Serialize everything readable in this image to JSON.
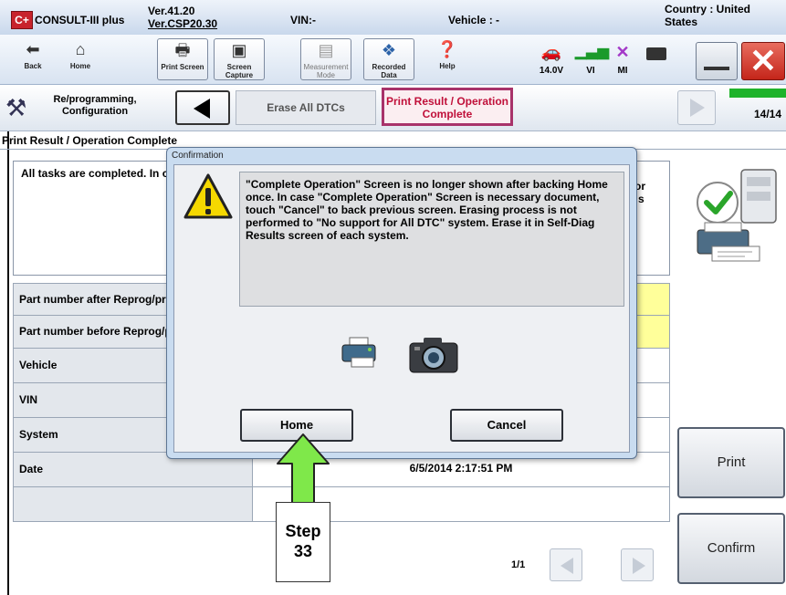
{
  "window": {
    "app_title": "CONSULT-III plus",
    "logo_text": "C+",
    "version_line1": "Ver.41.20",
    "version_line2": "Ver.CSP20.30",
    "vin_label": "VIN:-",
    "vehicle_label": "Vehicle : -",
    "country_label": "Country : United States"
  },
  "toolbar": {
    "back_label": "Back",
    "home_label": "Home",
    "print_screen_label": "Print Screen",
    "screen_capture_label": "Screen Capture",
    "measurement_mode_label": "Measurement Mode",
    "recorded_data_label": "Recorded Data",
    "help_label": "Help",
    "battery_voltage": "14.0V",
    "vi_label": "VI",
    "mi_label": "MI",
    "icons": [
      "back-arrow-icon",
      "home-icon",
      "printer-icon",
      "camera-icon",
      "measurement-icon",
      "recorded-data-icon",
      "help-icon",
      "car-icon",
      "signal-icon",
      "mi-x-icon",
      "close-icon",
      "minimize-icon"
    ]
  },
  "nav": {
    "reprog_label": "Re/programming, Configuration",
    "crumb_erase": "Erase All DTCs",
    "crumb_print": "Print Result / Operation Complete",
    "progress": "14/14",
    "progress_fraction": 1.0,
    "progress_color": "#1fb32b"
  },
  "page": {
    "title": "Print Result / Operation Complete",
    "message": "All tasks are completed. In case CONSULT can N temporally storage of thi Data Folder\" on desk top",
    "message_right_1": "or",
    "message_right_2": "s",
    "table": [
      {
        "label": "Part number after Reprog/programming",
        "value": "",
        "highlight": true
      },
      {
        "label": "Part number before Reprog/programming",
        "value": "",
        "highlight": true
      },
      {
        "label": "Vehicle",
        "value": "",
        "highlight": false
      },
      {
        "label": "VIN",
        "value": "",
        "highlight": false
      },
      {
        "label": "System",
        "value": "",
        "highlight": false
      },
      {
        "label": "Date",
        "value": "6/5/2014 2:17:51 PM",
        "highlight": false
      },
      {
        "label": "",
        "value": "",
        "highlight": false
      }
    ],
    "print_button": "Print",
    "confirm_button": "Confirm",
    "pager": "1/1"
  },
  "dialog": {
    "title": "Confirmation",
    "message": "\"Complete Operation\" Screen is no longer shown after backing Home once. In case \"Complete Operation\" Screen is necessary document, touch \"Cancel\" to back previous screen. Erasing process is not performed to \"No support for All DTC\" system. Erase it in Self-Diag Results screen of each system.",
    "home_button": "Home",
    "cancel_button": "Cancel",
    "icons": [
      "warning-icon",
      "printer-icon",
      "camera-icon"
    ]
  },
  "annotation": {
    "step_text": "Step 33",
    "arrow_color": "#7fe84a"
  }
}
